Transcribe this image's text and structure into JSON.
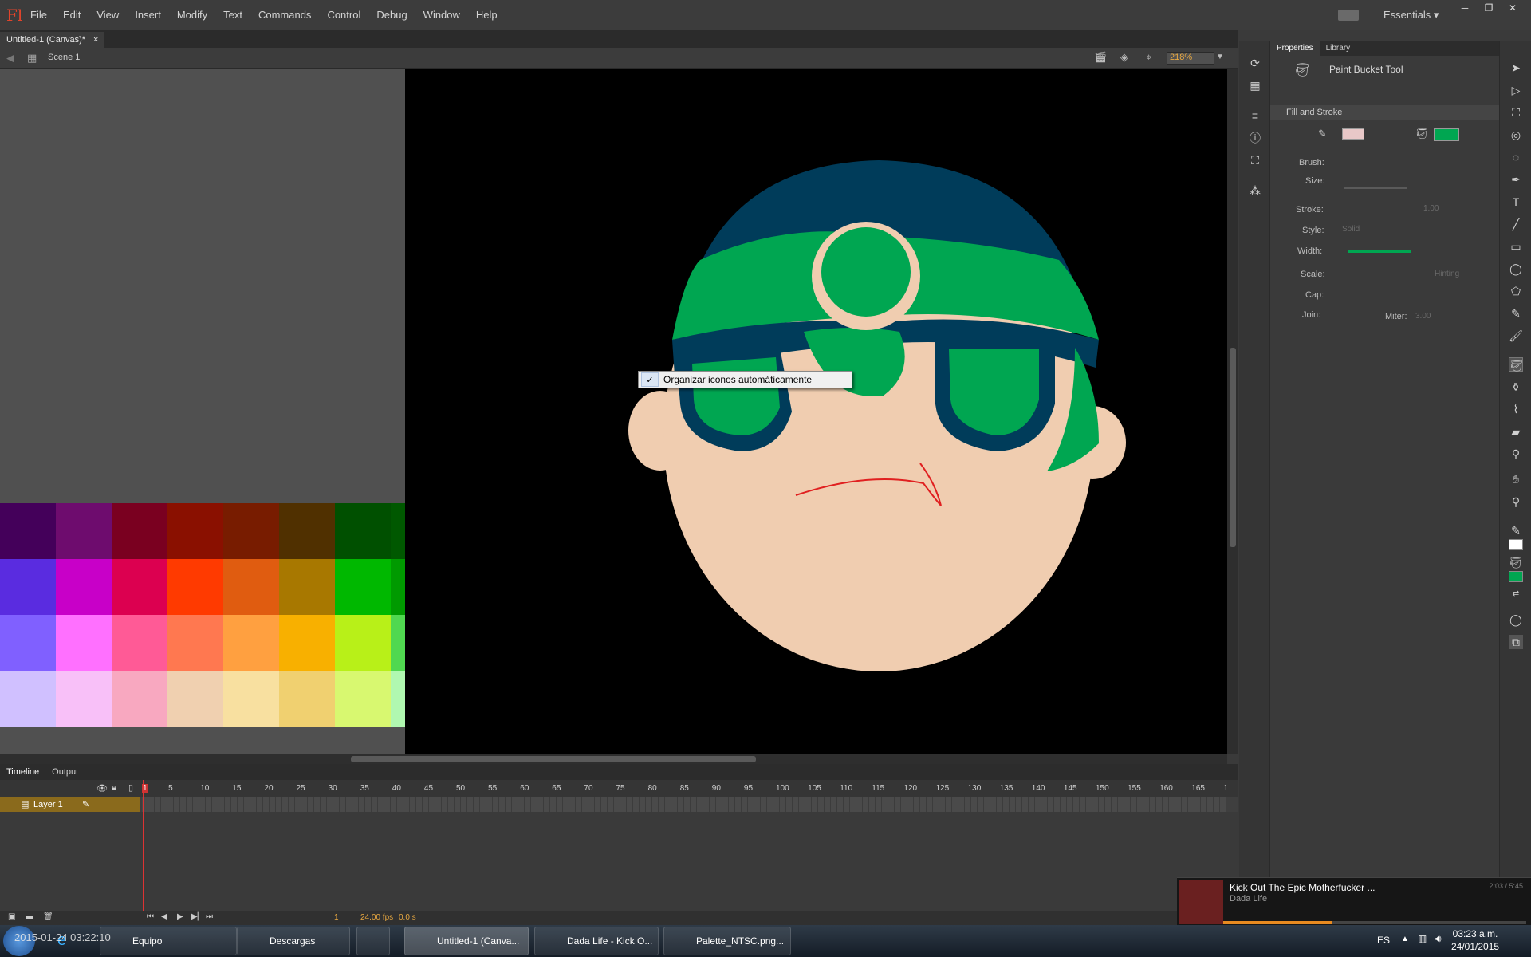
{
  "app": {
    "logo": "Fl"
  },
  "menu": [
    "File",
    "Edit",
    "View",
    "Insert",
    "Modify",
    "Text",
    "Commands",
    "Control",
    "Debug",
    "Window",
    "Help"
  ],
  "workspace": "Essentials",
  "doc_tab": {
    "label": "Untitled-1 (Canvas)*",
    "close": "×"
  },
  "edit_bar": {
    "scene": "Scene 1",
    "zoom": "218%"
  },
  "context_menu": {
    "item": "Organizar iconos automáticamente",
    "checked": "✓"
  },
  "timeline": {
    "tabs": [
      "Timeline",
      "Output"
    ],
    "layer": "Layer 1",
    "frame_numbers": [
      "1",
      "5",
      "10",
      "15",
      "20",
      "25",
      "30",
      "35",
      "40",
      "45",
      "50",
      "55",
      "60",
      "65",
      "70",
      "75",
      "80",
      "85",
      "90",
      "95",
      "100",
      "105",
      "110",
      "115",
      "120",
      "125",
      "130",
      "135",
      "140",
      "145",
      "150",
      "155",
      "160",
      "165",
      "1"
    ],
    "current_frame": "1",
    "fps": "24.00 fps",
    "time": "0.0 s"
  },
  "properties": {
    "tabs": [
      "Properties",
      "Library"
    ],
    "tool_name": "Paint Bucket Tool",
    "section": "Fill and Stroke",
    "labels": {
      "brush": "Brush:",
      "size": "Size:",
      "stroke": "Stroke:",
      "style": "Style:",
      "width": "Width:",
      "scale": "Scale:",
      "cap": "Cap:",
      "join": "Join:",
      "miter": "Miter:"
    },
    "values": {
      "stroke": "1.00",
      "style": "Solid",
      "hinting": "Hinting",
      "miter": "3.00"
    },
    "fill_color": "#00a651"
  },
  "palette": {
    "rows": [
      [
        "#44005a",
        "#6e0c6e",
        "#7a0020",
        "#8a1000",
        "#781c00",
        "#503000",
        "#005000",
        "#005800",
        "#00461a",
        "#003c5a"
      ],
      [
        "#5a2ce0",
        "#c800c8",
        "#dc0050",
        "#ff3a00",
        "#e05c10",
        "#a87800",
        "#00b800",
        "#009a00",
        "#00a84c",
        "#008088"
      ],
      [
        "#8060ff",
        "#ff70ff",
        "#ff5a96",
        "#ff7850",
        "#ffa040",
        "#f8b000",
        "#b8f018",
        "#50d850",
        "#50f890",
        "#00e0d0",
        "#787878"
      ],
      [
        "#d0c0ff",
        "#f8c0f8",
        "#f8a8c0",
        "#f0d0b0",
        "#f8e0a0",
        "#f0d070",
        "#d8f870",
        "#b0f8b0",
        "#b8f8d8",
        "#00ffff",
        "#f0d0f8"
      ]
    ]
  },
  "taskbar": {
    "items": [
      "Equipo",
      "Descargas",
      "",
      "Untitled-1 (Canva...",
      "Dada Life - Kick O...",
      "Palette_NTSC.png..."
    ],
    "lang": "ES",
    "time": "03:23 a.m.",
    "date": "24/01/2015",
    "watermark": "2015-01-24 03:22:10"
  },
  "media_toast": {
    "title": "Kick Out The Epic Motherfucker ...",
    "artist": "Dada Life",
    "time": "2:03 / 5:45",
    "progress": 0.36
  },
  "drawing": {
    "skin": "#f0cdb0",
    "hat_dark": "#003c5a",
    "hat_green": "#00a651",
    "hair": "#f2b100",
    "mouth": "#e02020"
  }
}
